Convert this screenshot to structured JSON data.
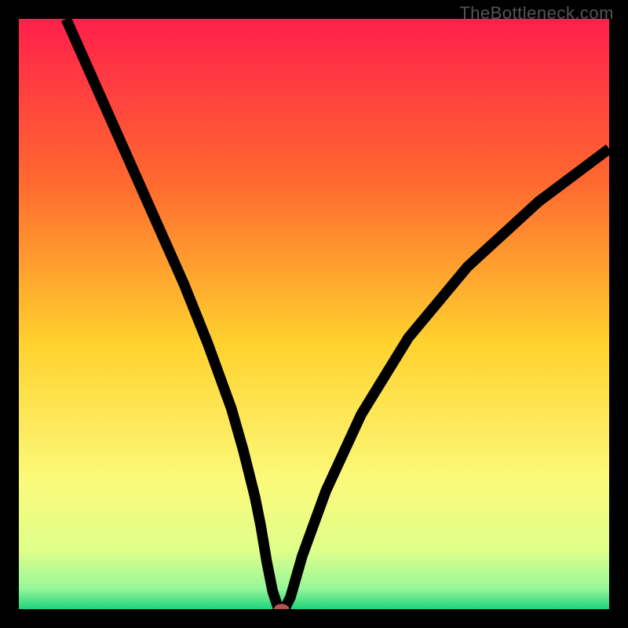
{
  "watermark": "TheBottleneck.com",
  "chart_data": {
    "type": "line",
    "title": "",
    "xlabel": "",
    "ylabel": "",
    "xlim": [
      0,
      100
    ],
    "ylim": [
      0,
      100
    ],
    "gradient_stops": [
      {
        "offset": 0,
        "color": "#ff1f4c"
      },
      {
        "offset": 0.28,
        "color": "#ff6a2f"
      },
      {
        "offset": 0.55,
        "color": "#ffd22e"
      },
      {
        "offset": 0.78,
        "color": "#fcf97a"
      },
      {
        "offset": 0.9,
        "color": "#dfff8a"
      },
      {
        "offset": 0.965,
        "color": "#97f79a"
      },
      {
        "offset": 1.0,
        "color": "#1fd47b"
      }
    ],
    "series": [
      {
        "name": "bottleneck-curve",
        "x": [
          8,
          12,
          16,
          20,
          24,
          28,
          32,
          36,
          38,
          40,
          41,
          42,
          43,
          44,
          45,
          46,
          48,
          52,
          58,
          66,
          76,
          88,
          100
        ],
        "values": [
          100,
          91,
          82,
          73,
          64,
          55,
          45,
          34,
          27,
          19,
          14,
          8,
          3,
          0,
          0,
          2,
          9,
          20,
          33,
          46,
          58,
          69,
          78
        ]
      }
    ],
    "marker": {
      "x": 44.5,
      "y": 0,
      "rx": 1.3,
      "ry": 0.9,
      "color": "#b9514e"
    }
  }
}
